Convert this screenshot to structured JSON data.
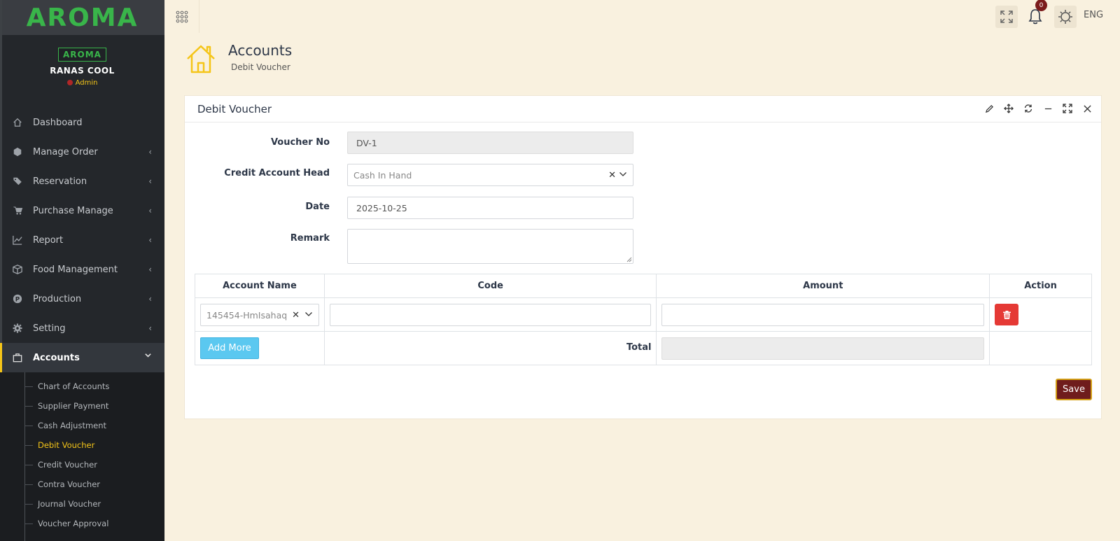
{
  "brand": {
    "logo_text": "AROMA",
    "profile_logo_text": "AROMA"
  },
  "profile": {
    "name": "RANAS COOL",
    "role": "Admin"
  },
  "sidebar": {
    "items": [
      {
        "label": "Dashboard",
        "icon": "home-icon"
      },
      {
        "label": "Manage Order",
        "icon": "cube-icon"
      },
      {
        "label": "Reservation",
        "icon": "tags-icon"
      },
      {
        "label": "Purchase Manage",
        "icon": "cart-icon"
      },
      {
        "label": "Report",
        "icon": "chart-line-icon"
      },
      {
        "label": "Food Management",
        "icon": "box-icon"
      },
      {
        "label": "Production",
        "icon": "production-icon"
      },
      {
        "label": "Setting",
        "icon": "gear-icon"
      },
      {
        "label": "Accounts",
        "icon": "briefcase-icon"
      }
    ],
    "accounts_sub": [
      "Chart of Accounts",
      "Supplier Payment",
      "Cash Adjustment",
      "Debit Voucher",
      "Credit Voucher",
      "Contra Voucher",
      "Journal Voucher",
      "Voucher Approval"
    ]
  },
  "topbar": {
    "notification_count": "0",
    "language": "ENG"
  },
  "page": {
    "title": "Accounts",
    "subtitle": "Debit Voucher"
  },
  "panel": {
    "title": "Debit Voucher"
  },
  "form": {
    "voucher_no_label": "Voucher No",
    "voucher_no_value": "DV-1",
    "credit_head_label": "Credit Account Head",
    "credit_head_value": "Cash In Hand",
    "date_label": "Date",
    "date_value": "2025-10-25",
    "remark_label": "Remark",
    "remark_value": ""
  },
  "table": {
    "headers": [
      "Account Name",
      "Code",
      "Amount",
      "Action"
    ],
    "row": {
      "account": "145454-HmIsahaq",
      "code": "",
      "amount": ""
    },
    "add_more_label": "Add More",
    "total_label": "Total",
    "total_value": ""
  },
  "save_label": "Save",
  "colors": {
    "brand_green": "#39b54a",
    "accent_yellow": "#f5c518",
    "save_maroon": "#6f1c1c",
    "delete_red": "#e53935",
    "add_blue": "#5bc8f0"
  }
}
